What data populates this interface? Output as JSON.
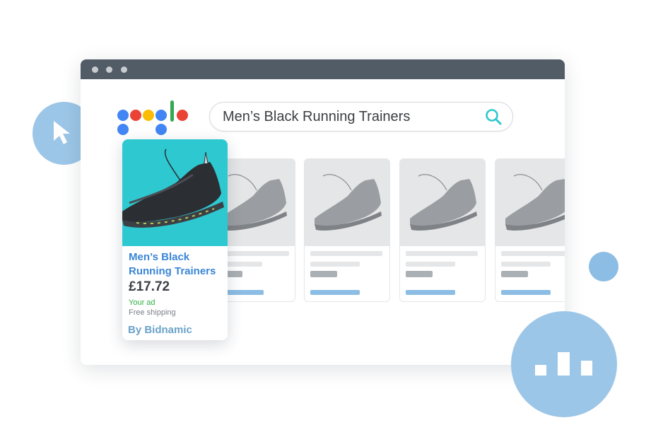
{
  "search": {
    "query": "Men’s Black Running Trainers"
  },
  "ad": {
    "title": "Men’s Black Running Trainers",
    "price": "£17.72",
    "badge": "Your ad",
    "shipping": "Free shipping",
    "by": "By Bidnamic"
  },
  "icons": {
    "search": "search-icon",
    "cursor": "cursor-arrow-icon",
    "stats": "bar-chart-icon",
    "logo": "google-logo"
  },
  "colors": {
    "titlebar": "#525c66",
    "ad_background": "#2ec8d1",
    "ad_title": "#3b86d6",
    "ad_badge": "#2fb043",
    "accent_bubble": "#9cc6e7",
    "logo_blue": "#4285f4",
    "logo_red": "#ea4335",
    "logo_yellow": "#fbbc05",
    "logo_green": "#34a853"
  }
}
